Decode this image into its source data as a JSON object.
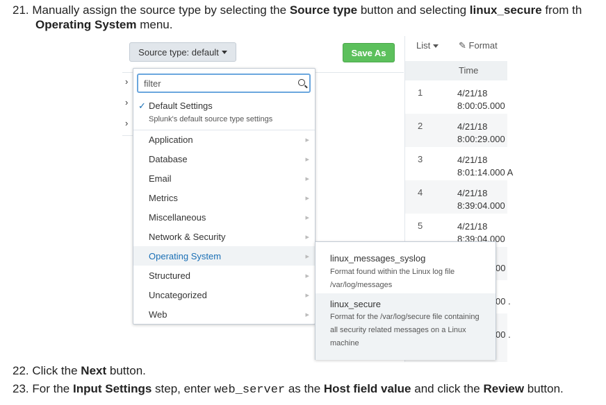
{
  "step21": {
    "num": "21.",
    "t1": "Manually assign the source type by selecting the ",
    "b1": "Source type",
    "t2": " button and selecting ",
    "b2": "linux_secure",
    "t3": " from th",
    "b3": "Operating System",
    "t4": " menu."
  },
  "toolbar": {
    "source_type_label": "Source type: default",
    "save_as_label": "Save As"
  },
  "table": {
    "list_label": "List",
    "format_label": "Format",
    "time_header": "Time",
    "rows": [
      {
        "idx": "1",
        "date": "4/21/18",
        "time": "8:00:05.000"
      },
      {
        "idx": "2",
        "date": "4/21/18",
        "time": "8:00:29.000"
      },
      {
        "idx": "3",
        "date": "4/21/18",
        "time": "8:01:14.000 A"
      },
      {
        "idx": "4",
        "date": "4/21/18",
        "time": "8:39:04.000"
      },
      {
        "idx": "5",
        "date": "4/21/18",
        "time": "8:39:04.000"
      }
    ],
    "partial_rows": [
      "00",
      "00 .",
      "00 ."
    ]
  },
  "dropdown": {
    "filter_placeholder": "filter",
    "default_label": "Default Settings",
    "default_desc": "Splunk's default source type settings",
    "items": [
      "Application",
      "Database",
      "Email",
      "Metrics",
      "Miscellaneous",
      "Network & Security",
      "Operating System",
      "Structured",
      "Uncategorized",
      "Web"
    ],
    "active_item": "Operating System"
  },
  "submenu": {
    "items": [
      {
        "title": "linux_messages_syslog",
        "desc1": "Format found within the Linux log file",
        "desc2": "/var/log/messages"
      },
      {
        "title": "linux_secure",
        "desc1": "Format for the /var/log/secure file containing",
        "desc2": "all security related messages on a Linux",
        "desc3": "machine"
      }
    ]
  },
  "step22": {
    "num": "22.",
    "t1": "Click the ",
    "b1": "Next",
    "t2": " button."
  },
  "step23": {
    "num": "23.",
    "t1": "For the ",
    "b1": "Input Settings",
    "t2": " step, enter ",
    "code": "web_server",
    "t3": " as the ",
    "b2": "Host field value",
    "t4": " and click the ",
    "b3": "Review",
    "t5": " button."
  },
  "colors": {
    "accent_blue": "#1a6fb5",
    "save_green": "#5cc05c",
    "focus_border": "#6aa6de"
  }
}
